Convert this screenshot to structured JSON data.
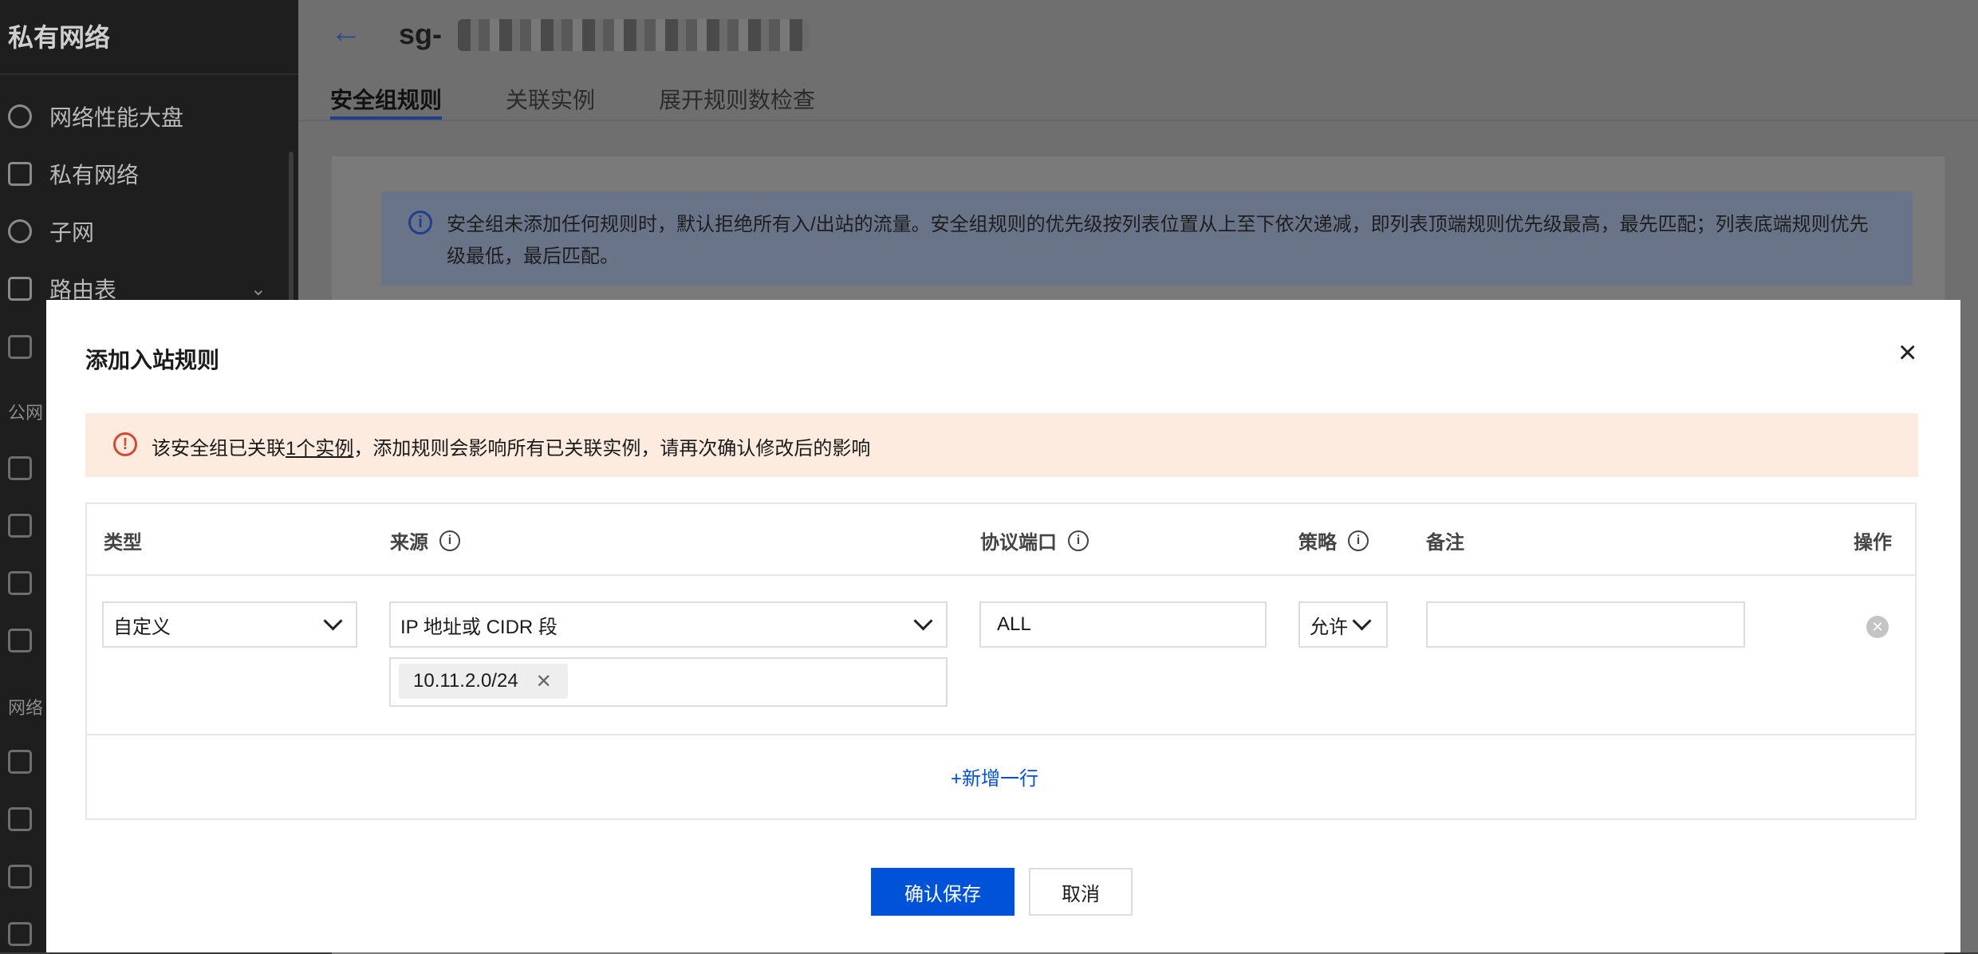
{
  "sidebar": {
    "brand": "私有网络",
    "items": [
      {
        "label": "网络性能大盘",
        "icon": "dashboard-icon"
      },
      {
        "label": "私有网络",
        "icon": "vpc-icon"
      },
      {
        "label": "子网",
        "icon": "globe-icon"
      },
      {
        "label": "路由表",
        "icon": "route-table-icon"
      }
    ],
    "groups": [
      "公网",
      "网络"
    ]
  },
  "header": {
    "back_icon": "←",
    "title_prefix": "sg-",
    "tabs": [
      {
        "label": "安全组规则",
        "active": true
      },
      {
        "label": "关联实例",
        "active": false
      },
      {
        "label": "展开规则数检查",
        "active": false
      }
    ]
  },
  "info_banner": {
    "text": "安全组未添加任何规则时，默认拒绝所有入/出站的流量。安全组规则的优先级按列表位置从上至下依次递减，即列表顶端规则优先级最高，最先匹配；列表底端规则优先级最低，最后匹配。"
  },
  "modal": {
    "title": "添加入站规则",
    "close_icon": "×",
    "warning": {
      "prefix": "该安全组已关联",
      "link": "1个实例",
      "suffix": "，添加规则会影响所有已关联实例，请再次确认修改后的影响"
    },
    "table": {
      "headers": {
        "type": "类型",
        "source": "来源",
        "port": "协议端口",
        "policy": "策略",
        "remark": "备注",
        "action": "操作"
      },
      "row": {
        "type": "自定义",
        "source_type": "IP 地址或 CIDR 段",
        "source_tag": "10.11.2.0/24",
        "port": "ALL",
        "policy": "允许",
        "remark": ""
      },
      "add_row": "+新增一行"
    },
    "buttons": {
      "confirm": "确认保存",
      "cancel": "取消"
    }
  },
  "colors": {
    "primary": "#0052d9",
    "warning_bg": "#fdebe0",
    "warning_icon": "#d44a2a"
  }
}
